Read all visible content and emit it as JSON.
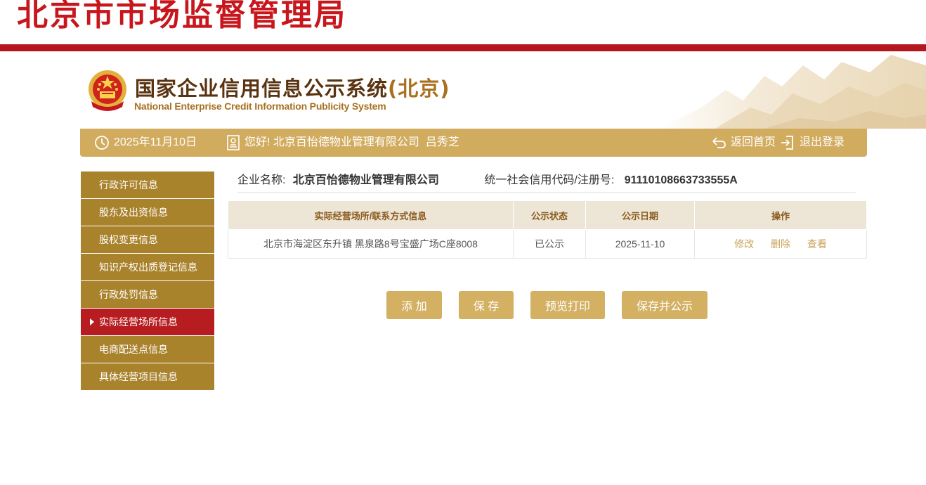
{
  "header": {
    "title": "北京市市场监督管理局"
  },
  "banner": {
    "title_main": "国家企业信用信息公示系统",
    "title_region": "(北京)",
    "subtitle": "National Enterprise Credit Information Publicity System"
  },
  "infobar": {
    "date": "2025年11月10日",
    "greeting": "您好! 北京百怡德物业管理有限公司  吕秀芝",
    "home_label": "返回首页",
    "logout_label": "退出登录",
    "bg_color": "#d1ac5f"
  },
  "sidebar": {
    "items": [
      {
        "label": "行政许可信息",
        "active": false
      },
      {
        "label": "股东及出资信息",
        "active": false
      },
      {
        "label": "股权变更信息",
        "active": false
      },
      {
        "label": "知识产权出质登记信息",
        "active": false
      },
      {
        "label": "行政处罚信息",
        "active": false
      },
      {
        "label": "实际经营场所信息",
        "active": true
      },
      {
        "label": "电商配送点信息",
        "active": false
      },
      {
        "label": "具体经营项目信息",
        "active": false
      }
    ]
  },
  "company": {
    "name_label": "企业名称:",
    "name_value": "北京百怡德物业管理有限公司",
    "code_label": "统一社会信用代码/注册号:",
    "code_value": "91110108663733555A"
  },
  "table": {
    "headers": [
      "实际经营场所/联系方式信息",
      "公示状态",
      "公示日期",
      "操作"
    ],
    "rows": [
      {
        "address": "北京市海淀区东升镇 黑泉路8号宝盛广场C座8008",
        "status": "已公示",
        "date": "2025-11-10",
        "actions": [
          "修改",
          "删除",
          "查看"
        ]
      }
    ]
  },
  "buttons": {
    "add": "添 加",
    "save": "保 存",
    "preview_print": "预览打印",
    "save_publish": "保存并公示"
  },
  "colors": {
    "brand_red": "#c8161d",
    "gold": "#d1ac5f",
    "sidebar": "#a9822c",
    "sidebar_active": "#b71c20"
  }
}
